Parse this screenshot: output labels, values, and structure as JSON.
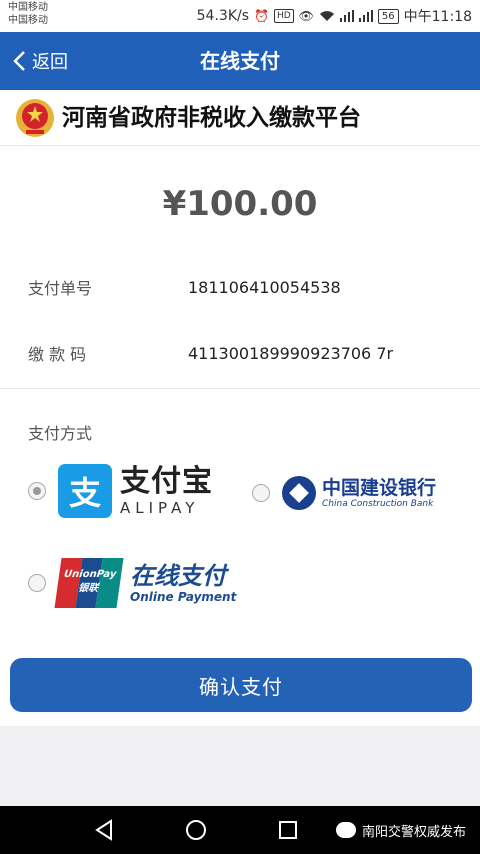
{
  "status_bar": {
    "carrier1": "中国移动",
    "carrier2": "中国移动",
    "speed": "54.3K/s",
    "hd": "HD",
    "signal1": "4G",
    "signal2": "2G",
    "battery": "56",
    "time": "中午11:18"
  },
  "nav": {
    "back_label": "返回",
    "title": "在线支付"
  },
  "banner": {
    "title": "河南省政府非税收入缴款平台"
  },
  "payment": {
    "amount": "¥100.00",
    "order_label": "支付单号",
    "order_value": "181106410054538",
    "code_label": "缴 款 码",
    "code_value": "411300189990923706 7r",
    "method_label": "支付方式"
  },
  "methods": {
    "alipay_cn": "支付宝",
    "alipay_en": "ALIPAY",
    "alipay_mark": "支",
    "ccb_cn": "中国建设银行",
    "ccb_en": "China Construction Bank",
    "unionpay_mark": "UnionPay 银联",
    "unionpay_cn": "在线支付",
    "unionpay_en": "Online Payment",
    "selected": "alipay"
  },
  "confirm_label": "确认支付",
  "watermark": "南阳交警权威发布",
  "colors": {
    "primary": "#2060b8",
    "alipay": "#1a9be6",
    "ccb": "#1b3f8f"
  }
}
